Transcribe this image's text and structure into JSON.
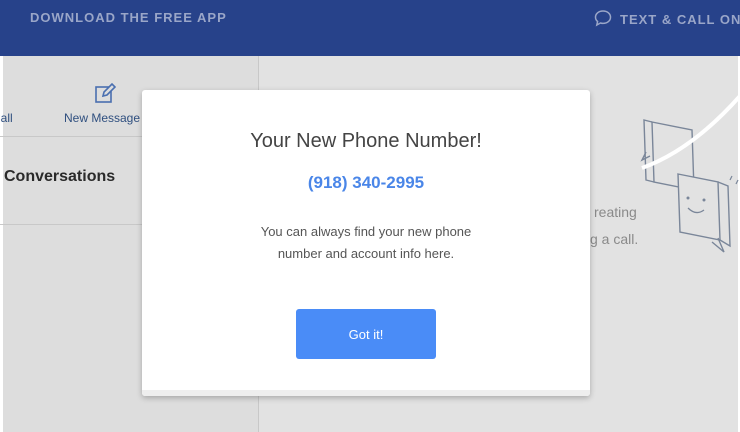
{
  "topbar": {
    "download_label": "DOWNLOAD THE FREE APP",
    "text_call_label": "TEXT & CALL ON",
    "chat_icon": "chat-bubble-icon"
  },
  "toolbar": {
    "call_label": "Call",
    "new_message_label": "New Message",
    "new_message_icon": "compose-icon"
  },
  "sidebar": {
    "conversations_title": "Conversations"
  },
  "empty_state": {
    "line1": "reating",
    "line2": "g a call."
  },
  "modal": {
    "title": "Your New Phone Number!",
    "phone_number": "(918) 340-2995",
    "description_line1": "You can always find your new phone",
    "description_line2": "number and account info here.",
    "button_label": "Got it!"
  },
  "colors": {
    "topbar": "#27428a",
    "accent": "#4a8cf7",
    "phone": "#4a86e8"
  }
}
